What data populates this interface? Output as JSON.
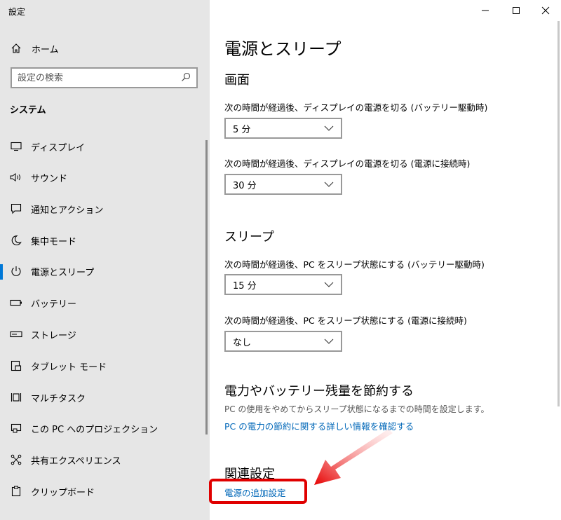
{
  "window": {
    "title": "設定"
  },
  "sidebar": {
    "home_label": "ホーム",
    "search_placeholder": "設定の検索",
    "section_title": "システム",
    "items": [
      {
        "label": "ディスプレイ",
        "icon": "monitor-icon"
      },
      {
        "label": "サウンド",
        "icon": "speaker-icon"
      },
      {
        "label": "通知とアクション",
        "icon": "notification-icon"
      },
      {
        "label": "集中モード",
        "icon": "moon-icon"
      },
      {
        "label": "電源とスリープ",
        "icon": "power-icon",
        "active": true
      },
      {
        "label": "バッテリー",
        "icon": "battery-icon"
      },
      {
        "label": "ストレージ",
        "icon": "storage-icon"
      },
      {
        "label": "タブレット モード",
        "icon": "tablet-icon"
      },
      {
        "label": "マルチタスク",
        "icon": "multitask-icon"
      },
      {
        "label": "この PC へのプロジェクション",
        "icon": "projection-icon"
      },
      {
        "label": "共有エクスペリエンス",
        "icon": "shared-icon"
      },
      {
        "label": "クリップボード",
        "icon": "clipboard-icon"
      }
    ]
  },
  "main": {
    "title": "電源とスリープ",
    "screen": {
      "heading": "画面",
      "battery_label": "次の時間が経過後、ディスプレイの電源を切る (バッテリー駆動時)",
      "battery_value": "5 分",
      "plugged_label": "次の時間が経過後、ディスプレイの電源を切る (電源に接続時)",
      "plugged_value": "30 分"
    },
    "sleep": {
      "heading": "スリープ",
      "battery_label": "次の時間が経過後、PC をスリープ状態にする (バッテリー駆動時)",
      "battery_value": "15 分",
      "plugged_label": "次の時間が経過後、PC をスリープ状態にする (電源に接続時)",
      "plugged_value": "なし"
    },
    "save": {
      "heading": "電力やバッテリー残量を節約する",
      "desc": "PC の使用をやめてからスリープ状態になるまでの時間を設定します。",
      "link": "PC の電力の節約に関する詳しい情報を確認する"
    },
    "related": {
      "heading": "関連設定",
      "link": "電源の追加設定"
    }
  },
  "colors": {
    "accent": "#0078d7",
    "link": "#0067b8",
    "highlight": "#e00000"
  }
}
